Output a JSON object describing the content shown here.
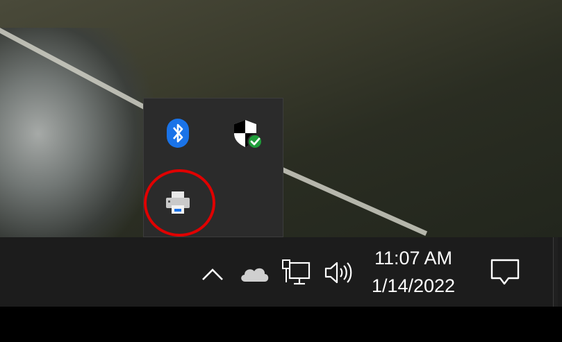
{
  "tray": {
    "overflow_icons": [
      {
        "icon": "bluetooth-icon"
      },
      {
        "icon": "windows-security-icon"
      },
      {
        "icon": "printer-icon"
      }
    ],
    "show_hidden": {
      "icon": "chevron-up-icon"
    },
    "onedrive": {
      "icon": "onedrive-cloud-icon"
    },
    "network": {
      "icon": "network-wired-icon"
    },
    "volume": {
      "icon": "volume-icon"
    }
  },
  "clock": {
    "time": "11:07 AM",
    "date": "1/14/2022"
  },
  "action_center": {
    "icon": "notification-icon"
  },
  "colors": {
    "taskbar": "#1c1c1c",
    "flyout": "#2b2b2b",
    "bluetooth": "#1a73e8",
    "security_check": "#1f9d3a",
    "highlight": "#e00000"
  }
}
